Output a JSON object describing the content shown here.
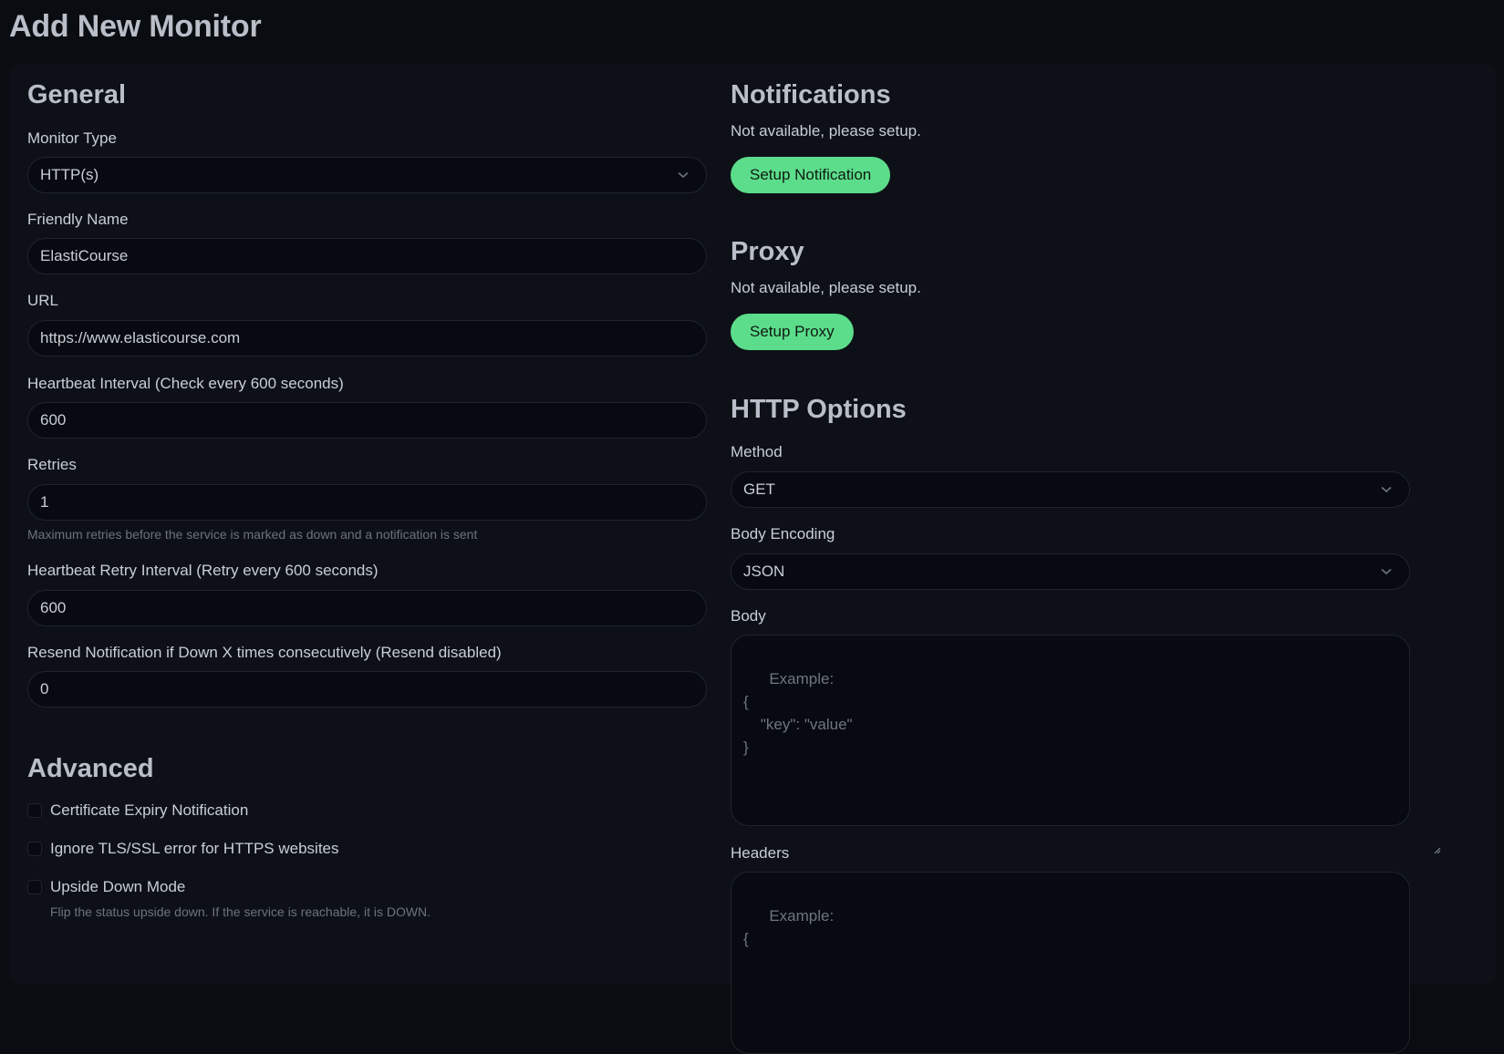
{
  "page": {
    "title": "Add New Monitor"
  },
  "general": {
    "heading": "General",
    "monitor_type": {
      "label": "Monitor Type",
      "value": "HTTP(s)"
    },
    "friendly_name": {
      "label": "Friendly Name",
      "value": "ElastiCourse"
    },
    "url": {
      "label": "URL",
      "value": "https://www.elasticourse.com"
    },
    "heartbeat_interval": {
      "label": "Heartbeat Interval (Check every 600 seconds)",
      "value": "600"
    },
    "retries": {
      "label": "Retries",
      "value": "1",
      "help": "Maximum retries before the service is marked as down and a notification is sent"
    },
    "retry_interval": {
      "label": "Heartbeat Retry Interval (Retry every 600 seconds)",
      "value": "600"
    },
    "resend": {
      "label": "Resend Notification if Down X times consecutively (Resend disabled)",
      "value": "0"
    }
  },
  "advanced": {
    "heading": "Advanced",
    "options": [
      {
        "label": "Certificate Expiry Notification",
        "checked": false
      },
      {
        "label": "Ignore TLS/SSL error for HTTPS websites",
        "checked": false
      },
      {
        "label": "Upside Down Mode",
        "checked": false,
        "help": "Flip the status upside down. If the service is reachable, it is DOWN."
      }
    ]
  },
  "notifications": {
    "heading": "Notifications",
    "message": "Not available, please setup.",
    "button": "Setup Notification"
  },
  "proxy": {
    "heading": "Proxy",
    "message": "Not available, please setup.",
    "button": "Setup Proxy"
  },
  "http_options": {
    "heading": "HTTP Options",
    "method": {
      "label": "Method",
      "value": "GET"
    },
    "body_encoding": {
      "label": "Body Encoding",
      "value": "JSON"
    },
    "body": {
      "label": "Body",
      "placeholder": "Example:\n{\n    \"key\": \"value\"\n}"
    },
    "headers": {
      "label": "Headers",
      "placeholder": "Example:\n{"
    }
  },
  "colors": {
    "accent_green": "#5cdd8b",
    "page_bg": "#090c10",
    "card_bg": "#0d1117"
  },
  "icons": {
    "select_chevron": "chevron-down-icon",
    "resize": "resize-handle-icon"
  }
}
